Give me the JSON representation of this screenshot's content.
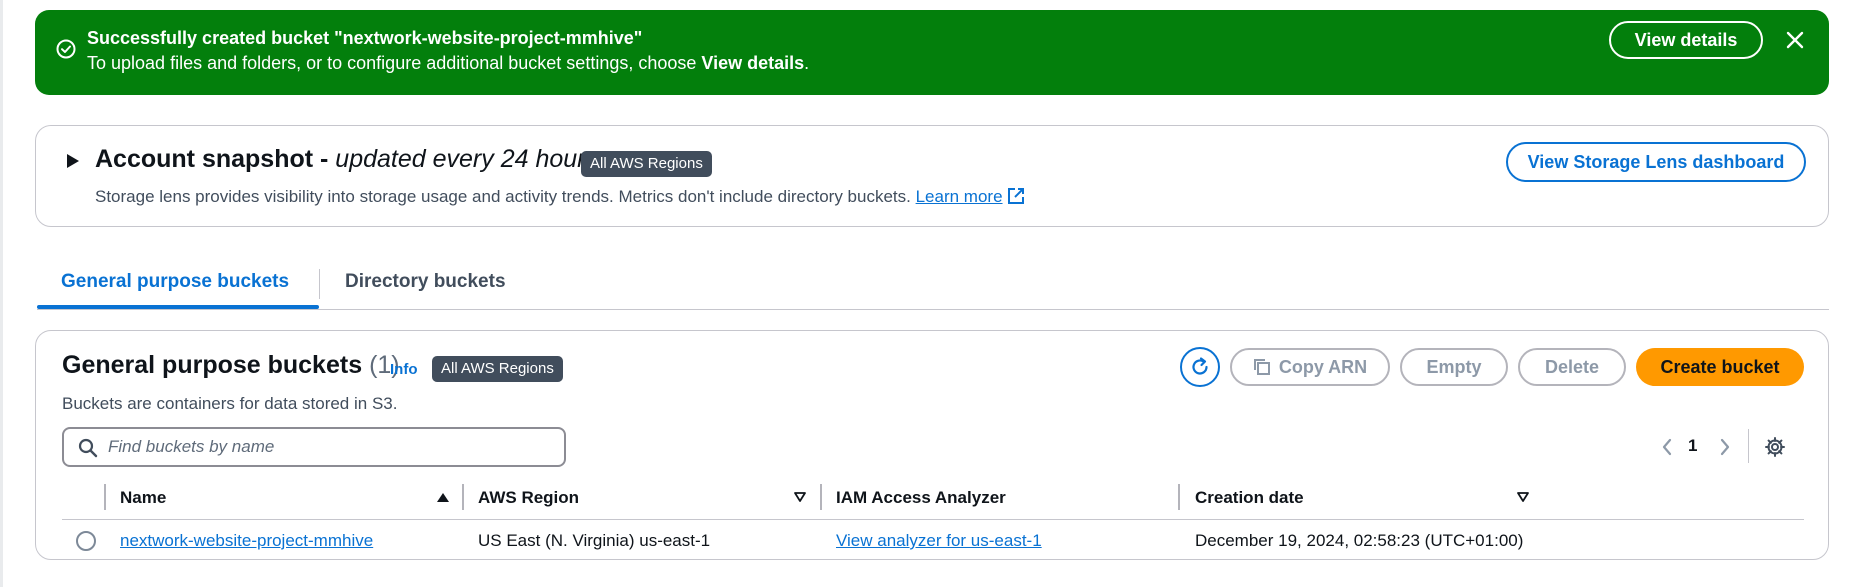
{
  "flash": {
    "title": "Successfully created bucket \"nextwork-website-project-mmhive\"",
    "desc_prefix": "To upload files and folders, or to configure additional bucket settings, choose ",
    "desc_bold": "View details",
    "desc_suffix": ".",
    "view_details_label": "View details",
    "color": "#037f0c"
  },
  "snapshot": {
    "heading": "Account snapshot - ",
    "heading_italic": "updated every 24 hours",
    "badge": "All AWS Regions",
    "desc": "Storage lens provides visibility into storage usage and activity trends. Metrics don't include directory buckets. ",
    "learn_more": "Learn more",
    "button_label": "View Storage Lens dashboard"
  },
  "tabs": [
    {
      "label": "General purpose buckets",
      "active": true
    },
    {
      "label": "Directory buckets",
      "active": false
    }
  ],
  "panel": {
    "title": "General purpose buckets",
    "count": "(1)",
    "info": "Info",
    "badge": "All AWS Regions",
    "desc": "Buckets are containers for data stored in S3.",
    "actions": {
      "copy_arn": "Copy ARN",
      "empty": "Empty",
      "delete": "Delete",
      "create": "Create bucket"
    },
    "search_placeholder": "Find buckets by name",
    "page": "1",
    "columns": [
      "Name",
      "AWS Region",
      "IAM Access Analyzer",
      "Creation date"
    ],
    "rows": [
      {
        "name": "nextwork-website-project-mmhive",
        "region": "US East (N. Virginia) us-east-1",
        "analyzer": "View analyzer for us-east-1",
        "created": "December 19, 2024, 02:58:23 (UTC+01:00)"
      }
    ]
  },
  "colors": {
    "accent": "#0972d3",
    "primary_button": "#ff9900",
    "badge": "#414d5c"
  }
}
